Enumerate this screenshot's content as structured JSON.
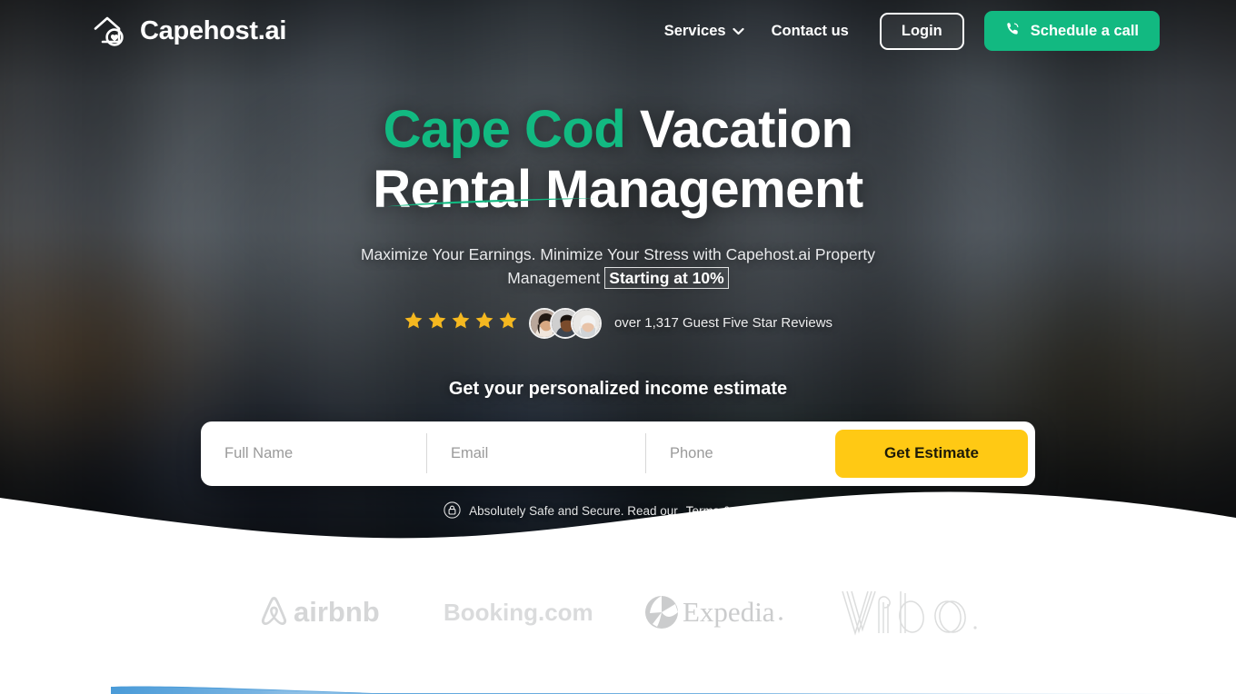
{
  "brand": {
    "name": "Capehost.ai",
    "logo_icon": "house-heart-icon",
    "accent_green": "#12B981",
    "accent_yellow": "#FFC914",
    "star_gold": "#F5B820"
  },
  "nav": {
    "items": [
      {
        "label": "Services",
        "icon": "chevron-down-icon",
        "has_dropdown": true
      },
      {
        "label": "Contact us",
        "icon": "",
        "has_dropdown": false
      }
    ],
    "login_label": "Login",
    "call_label": "Schedule a call",
    "call_icon": "phone-icon"
  },
  "hero": {
    "headline_accent": "Cape Cod",
    "headline_rest": " Vacation",
    "headline_line2": "Rental Management",
    "subhead_part1": "Maximize Your Earnings. Minimize Your Stress with Capehost.ai Property Management ",
    "subhead_badge": "Starting at 10%",
    "reviews": {
      "stars": 5,
      "star_count_label": "★",
      "avatars": [
        "avatar-woman-dark-hair",
        "avatar-man",
        "avatar-woman-white-hair"
      ],
      "text": "over 1,317 Guest Five Star Reviews",
      "review_count": "1,317"
    },
    "form": {
      "title": "Get your personalized income estimate",
      "fields": [
        {
          "name": "full-name",
          "placeholder": "Full Name",
          "value": ""
        },
        {
          "name": "email",
          "placeholder": "Email",
          "value": ""
        },
        {
          "name": "phone",
          "placeholder": "Phone",
          "value": ""
        }
      ],
      "submit_label": "Get Estimate"
    },
    "secure": {
      "icon": "lock-icon",
      "text": "Absolutely Safe and Secure. Read our ",
      "link_label": "Terms & Conditions"
    }
  },
  "partners": {
    "logos": [
      {
        "name": "airbnb",
        "label": "airbnb"
      },
      {
        "name": "booking-com",
        "label": "Booking.com"
      },
      {
        "name": "expedia",
        "label": "Expedia"
      },
      {
        "name": "vrbo",
        "label": "Vrbo"
      }
    ]
  }
}
